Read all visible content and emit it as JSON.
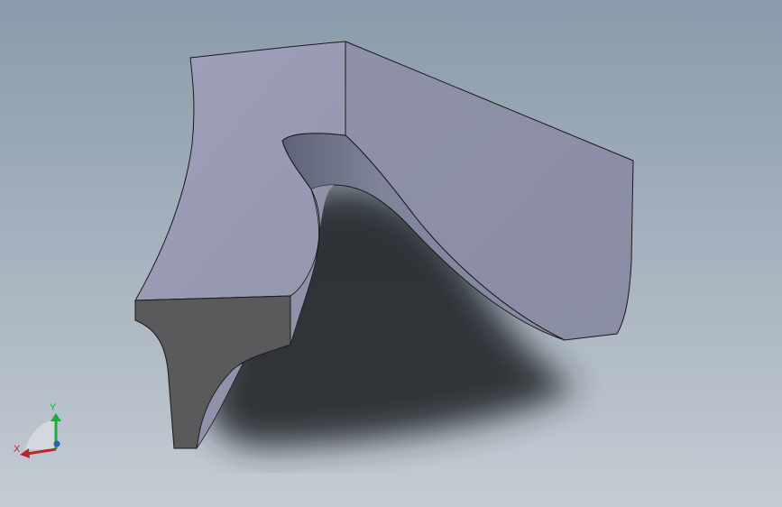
{
  "triad": {
    "x_label": "X",
    "y_label": "Y",
    "x_color": "#c0262b",
    "y_color": "#1faa3a",
    "z_color": "#2a5cc0"
  },
  "colors": {
    "top_face": "#9a9cb4",
    "side_face": "#8c8fa6",
    "curved_face": "#7c8096",
    "end_face": "#5a5a5c",
    "edge": "#1a1a1a"
  }
}
